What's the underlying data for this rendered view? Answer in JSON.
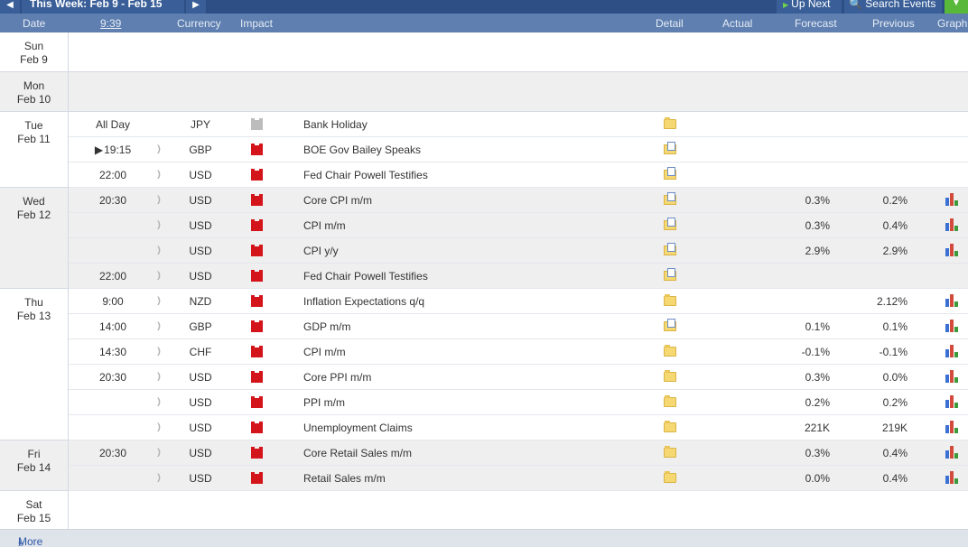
{
  "toolbar": {
    "prev_icon": "chevron-left-icon",
    "week_label": "This Week: Feb 9 - Feb 15",
    "next_icon": "chevron-right-icon",
    "up_next_label": "Up Next",
    "search_label": "Search Events",
    "filter_icon": "filter-icon",
    "accent_color": "#2d4f85",
    "filter_color": "#57b83a"
  },
  "columns": {
    "date": "Date",
    "time": "9:39",
    "currency": "Currency",
    "impact": "Impact",
    "detail": "Detail",
    "actual": "Actual",
    "forecast": "Forecast",
    "previous": "Previous",
    "graph": "Graph"
  },
  "days": [
    {
      "dow": "Sun",
      "date": "Feb 9",
      "events": []
    },
    {
      "dow": "Mon",
      "date": "Feb 10",
      "events": []
    },
    {
      "dow": "Tue",
      "date": "Feb 11",
      "events": [
        {
          "time": "All Day",
          "currency": "JPY",
          "impact": "non-economic",
          "event": "Bank Holiday",
          "forecast": "",
          "previous": "",
          "graph": false
        },
        {
          "time": "19:15",
          "currency": "GBP",
          "impact": "high",
          "event": "BOE Gov Bailey Speaks",
          "forecast": "",
          "previous": "",
          "graph": false
        },
        {
          "time": "22:00",
          "currency": "USD",
          "impact": "high",
          "event": "Fed Chair Powell Testifies",
          "forecast": "",
          "previous": "",
          "graph": false
        }
      ]
    },
    {
      "dow": "Wed",
      "date": "Feb 12",
      "events": [
        {
          "time": "20:30",
          "currency": "USD",
          "impact": "high",
          "event": "Core CPI m/m",
          "forecast": "0.3%",
          "previous": "0.2%",
          "graph": true
        },
        {
          "time": "",
          "currency": "USD",
          "impact": "high",
          "event": "CPI m/m",
          "forecast": "0.3%",
          "previous": "0.4%",
          "graph": true
        },
        {
          "time": "",
          "currency": "USD",
          "impact": "high",
          "event": "CPI y/y",
          "forecast": "2.9%",
          "previous": "2.9%",
          "graph": true
        },
        {
          "time": "22:00",
          "currency": "USD",
          "impact": "high",
          "event": "Fed Chair Powell Testifies",
          "forecast": "",
          "previous": "",
          "graph": false
        }
      ]
    },
    {
      "dow": "Thu",
      "date": "Feb 13",
      "events": [
        {
          "time": "9:00",
          "currency": "NZD",
          "impact": "high",
          "event": "Inflation Expectations q/q",
          "forecast": "",
          "previous": "2.12%",
          "graph": true
        },
        {
          "time": "14:00",
          "currency": "GBP",
          "impact": "high",
          "event": "GDP m/m",
          "forecast": "0.1%",
          "previous": "0.1%",
          "graph": true
        },
        {
          "time": "14:30",
          "currency": "CHF",
          "impact": "high",
          "event": "CPI m/m",
          "forecast": "-0.1%",
          "previous": "-0.1%",
          "graph": true
        },
        {
          "time": "20:30",
          "currency": "USD",
          "impact": "high",
          "event": "Core PPI m/m",
          "forecast": "0.3%",
          "previous": "0.0%",
          "graph": true
        },
        {
          "time": "",
          "currency": "USD",
          "impact": "high",
          "event": "PPI m/m",
          "forecast": "0.2%",
          "previous": "0.2%",
          "graph": true
        },
        {
          "time": "",
          "currency": "USD",
          "impact": "high",
          "event": "Unemployment Claims",
          "forecast": "221K",
          "previous": "219K",
          "graph": true
        }
      ]
    },
    {
      "dow": "Fri",
      "date": "Feb 14",
      "events": [
        {
          "time": "20:30",
          "currency": "USD",
          "impact": "high",
          "event": "Core Retail Sales m/m",
          "forecast": "0.3%",
          "previous": "0.4%",
          "graph": true
        },
        {
          "time": "",
          "currency": "USD",
          "impact": "high",
          "event": "Retail Sales m/m",
          "forecast": "0.0%",
          "previous": "0.4%",
          "graph": true
        }
      ]
    },
    {
      "dow": "Sat",
      "date": "Feb 15",
      "events": []
    }
  ],
  "footer": {
    "more_label": "More",
    "more_icon": "download-arrow-icon"
  },
  "colors": {
    "high_impact": "#d3151b",
    "non_economic": "#bcbcbc",
    "header_bg": "#5e7fb0"
  }
}
